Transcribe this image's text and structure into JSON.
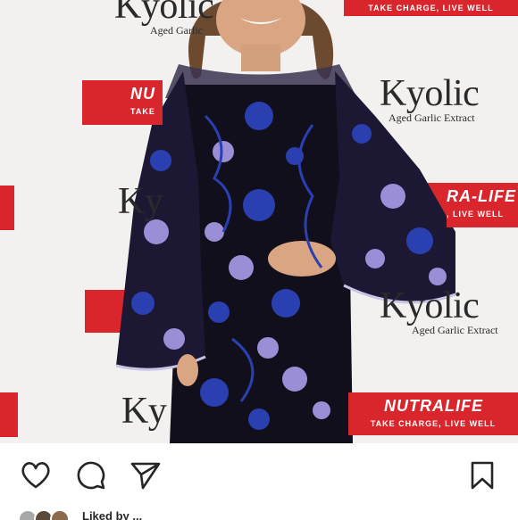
{
  "photo": {
    "backdrop": {
      "kyolic_wordmark": "Kyolic",
      "kyolic_tagline": "Aged Garlic Extract",
      "kyolic_partial_top": "Kyolic",
      "kyolic_partial_top_sub": "Aged Garlic",
      "kyolic_partial_left": "Ky",
      "nutralife_wordmark": "NUTRALIFE",
      "nutralife_partial": "NU",
      "nutralife_partial_right": "RA-LIFE",
      "nutralife_tagline": "TAKE CHARGE, LIVE WELL",
      "nutralife_tagline_short": "TAKE",
      "nutralife_tagline_partial": ", LIVE WELL",
      "red_color": "#d8262c"
    },
    "dress_colors": {
      "base": "#120f1c",
      "lace_blue": "#2a3fb0",
      "lace_lilac": "#9a8fd6"
    }
  },
  "actions": {
    "like_icon": "heart-icon",
    "comment_icon": "comment-icon",
    "share_icon": "paper-plane-icon",
    "save_icon": "bookmark-icon"
  },
  "likes": {
    "text": "Liked by ..."
  }
}
